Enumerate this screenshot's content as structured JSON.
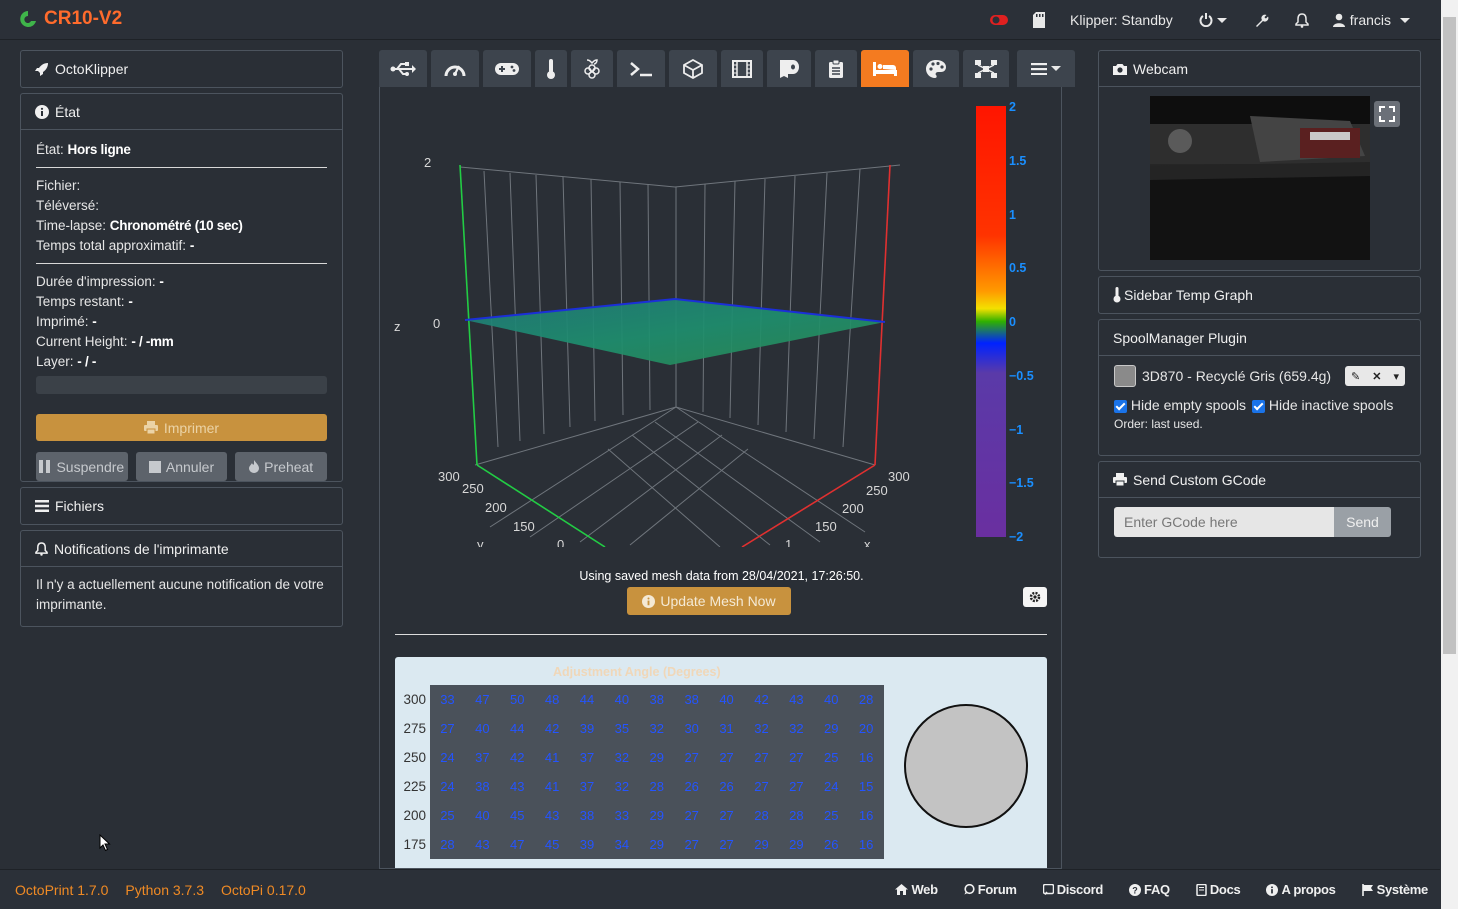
{
  "navbar": {
    "brand": "CR10-V2",
    "klipper_status": "Klipper: Standby",
    "user": "francis"
  },
  "left": {
    "octoklipper_title": "OctoKlipper",
    "state_title": "État",
    "state_label": "État:",
    "state_value": "Hors ligne",
    "file_label": "Fichier:",
    "uploaded_label": "Téléversé:",
    "timelapse_label": "Time-lapse:",
    "timelapse_value": "Chronométré (10 sec)",
    "approx_time_label": "Temps total approximatif:",
    "approx_time_value": "-",
    "print_time_label": "Durée d'impression:",
    "print_time_value": "-",
    "remaining_label": "Temps restant:",
    "remaining_value": "-",
    "printed_label": "Imprimé:",
    "printed_value": "-",
    "height_label": "Current Height:",
    "height_value": "- / -mm",
    "layer_label": "Layer:",
    "layer_value": "- / -",
    "print_button": "Imprimer",
    "pause_button": "Suspendre",
    "cancel_button": "Annuler",
    "preheat_button": "Preheat",
    "files_title": "Fichiers",
    "notifications_title": "Notifications de l'imprimante",
    "notifications_text": "Il n'y a actuellement aucune notification de votre imprimante."
  },
  "center": {
    "tabs": [
      "connection",
      "dashboard",
      "control",
      "temperature",
      "raspberry",
      "terminal",
      "gcode-viewer",
      "timelapse",
      "filament",
      "log",
      "bed-mesh",
      "palette",
      "plugin",
      "more"
    ],
    "active_tab": "bed-mesh",
    "plot": {
      "z_axis_label": "z",
      "z_ticks": [
        "2",
        "0"
      ],
      "y_axis_label": "y",
      "y_ticks": [
        "300",
        "250",
        "200",
        "150",
        "0"
      ],
      "x_axis_label": "x",
      "x_ticks": [
        "300",
        "250",
        "200",
        "150",
        "1"
      ],
      "colorbar_ticks": [
        "2",
        "1.5",
        "1",
        "0.5",
        "0",
        "−0.5",
        "−1",
        "−1.5",
        "−2"
      ],
      "colorbar_colors": [
        "#ff0000",
        "#ff3a00",
        "#ff6a00",
        "#ffd000",
        "#2bb400",
        "#0033ff",
        "#5f3aa8",
        "#6a2fa0"
      ]
    },
    "mesh_note": "Using saved mesh data from 28/04/2021, 17:26:50.",
    "update_button": "Update Mesh Now",
    "mesh_table_title": "Adjustment Angle (Degrees)",
    "mesh_rows": [
      {
        "y": "300",
        "vals": [
          "33",
          "47",
          "50",
          "48",
          "44",
          "40",
          "38",
          "38",
          "40",
          "42",
          "43",
          "40",
          "28"
        ]
      },
      {
        "y": "275",
        "vals": [
          "27",
          "40",
          "44",
          "42",
          "39",
          "35",
          "32",
          "30",
          "31",
          "32",
          "32",
          "29",
          "20"
        ]
      },
      {
        "y": "250",
        "vals": [
          "24",
          "37",
          "42",
          "41",
          "37",
          "32",
          "29",
          "27",
          "27",
          "27",
          "27",
          "25",
          "16"
        ]
      },
      {
        "y": "225",
        "vals": [
          "24",
          "38",
          "43",
          "41",
          "37",
          "32",
          "28",
          "26",
          "26",
          "27",
          "27",
          "24",
          "15"
        ]
      },
      {
        "y": "200",
        "vals": [
          "25",
          "40",
          "45",
          "43",
          "38",
          "33",
          "29",
          "27",
          "27",
          "28",
          "28",
          "25",
          "16"
        ]
      },
      {
        "y": "175",
        "vals": [
          "28",
          "43",
          "47",
          "45",
          "39",
          "34",
          "29",
          "27",
          "27",
          "29",
          "29",
          "26",
          "16"
        ]
      }
    ]
  },
  "right": {
    "webcam_title": "Webcam",
    "temp_graph_title": "Sidebar Temp Graph",
    "spool_title": "SpoolManager Plugin",
    "spool_name": "3D870 - Recyclé Gris (659.4g)",
    "hide_empty": "Hide empty spools",
    "hide_inactive": "Hide inactive spools",
    "order": "Order: last used.",
    "gcode_title": "Send Custom GCode",
    "gcode_placeholder": "Enter GCode here",
    "send_button": "Send"
  },
  "footer": {
    "octoprint": "OctoPrint 1.7.0",
    "python": "Python 3.7.3",
    "octopi": "OctoPi 0.17.0",
    "links": [
      "Web",
      "Forum",
      "Discord",
      "FAQ",
      "Docs",
      "A propos",
      "Système"
    ]
  }
}
